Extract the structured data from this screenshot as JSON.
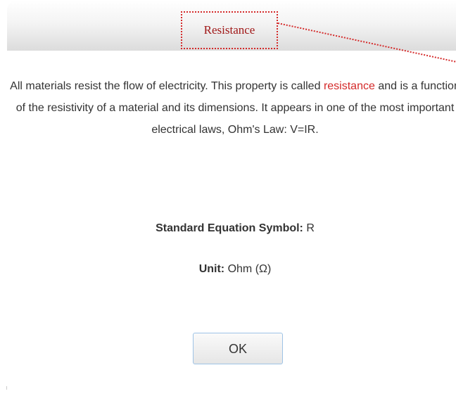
{
  "dialog": {
    "title": "Resistance",
    "paragraph_pre": "All materials resist the flow of electricity. This property is called",
    "highlight_term": "resistance",
    "paragraph_post": "and is a function of the resistivity of a material and its dimensions. It appears in one of the most important electrical laws, Ohm's Law: V=IR.",
    "symbol_label": "Standard Equation Symbol:",
    "symbol_value": "R",
    "unit_label": "Unit:",
    "unit_value": "Ohm (Ω)",
    "ok_label": "OK"
  },
  "colors": {
    "accent_red": "#d42a2a",
    "title_red": "#a01818",
    "button_border": "#9ec3e6",
    "text": "#333333"
  }
}
